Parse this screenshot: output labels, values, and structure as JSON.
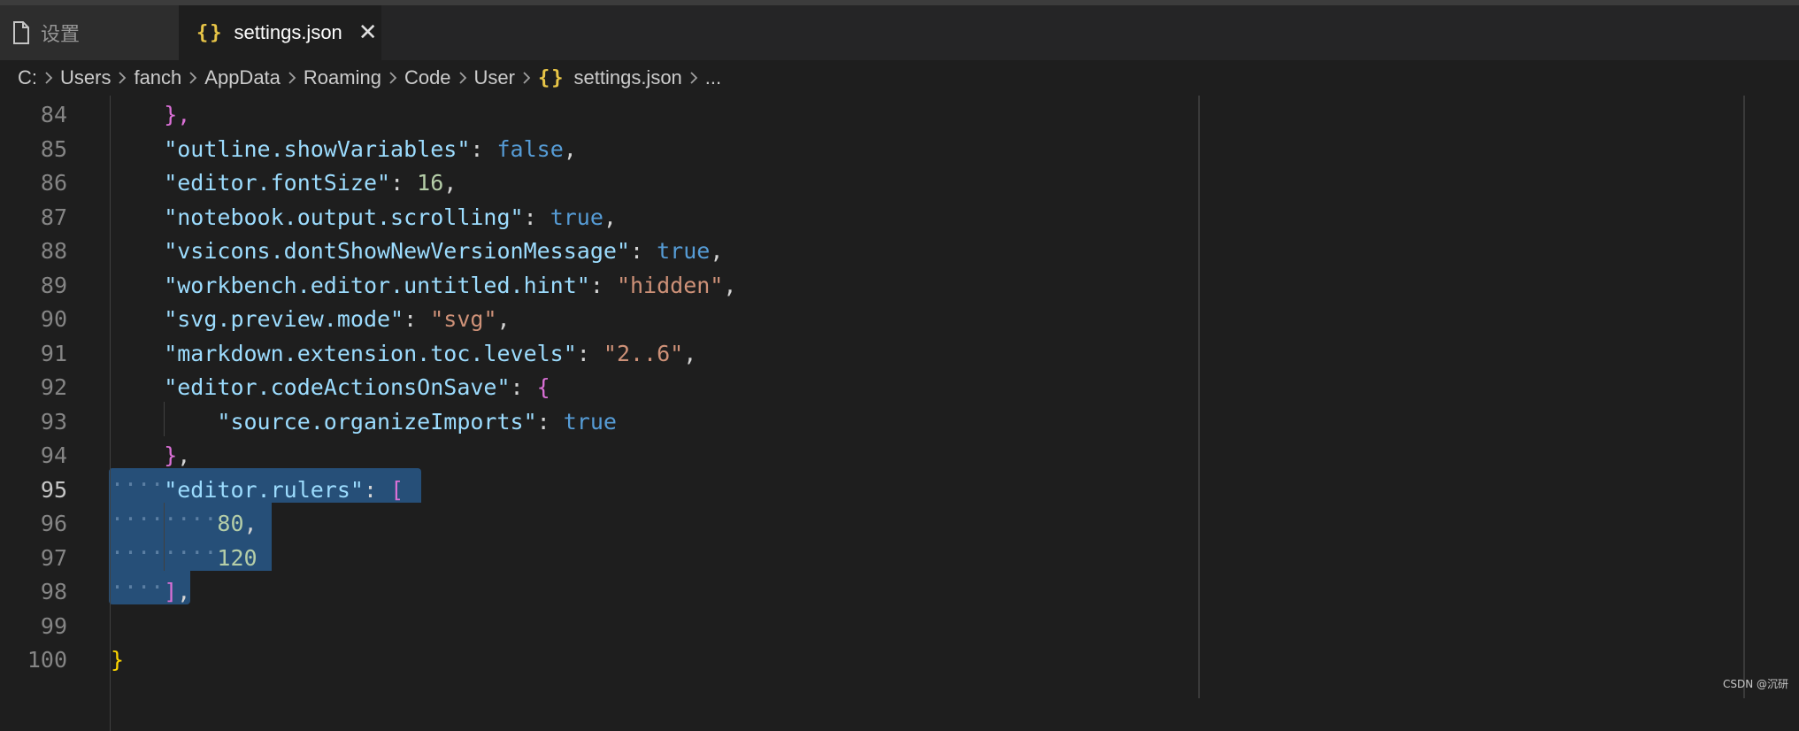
{
  "tabs": [
    {
      "label": "设置",
      "icon": "file-icon",
      "active": false
    },
    {
      "label": "settings.json",
      "icon": "json-braces-icon",
      "active": true,
      "close": "✕"
    }
  ],
  "breadcrumb": [
    "C:",
    "Users",
    "fanch",
    "AppData",
    "Roaming",
    "Code",
    "User",
    "settings.json",
    "..."
  ],
  "lines": [
    {
      "no": "84",
      "parts": [
        [
          "br1",
          "},"
        ]
      ]
    },
    {
      "no": "85",
      "parts": [
        [
          "k",
          "\"outline.showVariables\""
        ],
        [
          "p",
          ": "
        ],
        [
          "b",
          "false"
        ],
        [
          "p",
          ","
        ]
      ]
    },
    {
      "no": "86",
      "parts": [
        [
          "k",
          "\"editor.fontSize\""
        ],
        [
          "p",
          ": "
        ],
        [
          "n",
          "16"
        ],
        [
          "p",
          ","
        ]
      ]
    },
    {
      "no": "87",
      "parts": [
        [
          "k",
          "\"notebook.output.scrolling\""
        ],
        [
          "p",
          ": "
        ],
        [
          "b",
          "true"
        ],
        [
          "p",
          ","
        ]
      ]
    },
    {
      "no": "88",
      "parts": [
        [
          "k",
          "\"vsicons.dontShowNewVersionMessage\""
        ],
        [
          "p",
          ": "
        ],
        [
          "b",
          "true"
        ],
        [
          "p",
          ","
        ]
      ]
    },
    {
      "no": "89",
      "parts": [
        [
          "k",
          "\"workbench.editor.untitled.hint\""
        ],
        [
          "p",
          ": "
        ],
        [
          "s",
          "\"hidden\""
        ],
        [
          "p",
          ","
        ]
      ]
    },
    {
      "no": "90",
      "parts": [
        [
          "k",
          "\"svg.preview.mode\""
        ],
        [
          "p",
          ": "
        ],
        [
          "s",
          "\"svg\""
        ],
        [
          "p",
          ","
        ]
      ]
    },
    {
      "no": "91",
      "parts": [
        [
          "k",
          "\"markdown.extension.toc.levels\""
        ],
        [
          "p",
          ": "
        ],
        [
          "s",
          "\"2..6\""
        ],
        [
          "p",
          ","
        ]
      ]
    },
    {
      "no": "92",
      "parts": [
        [
          "k",
          "\"editor.codeActionsOnSave\""
        ],
        [
          "p",
          ": "
        ],
        [
          "br1",
          "{"
        ]
      ]
    },
    {
      "no": "93",
      "indent": 2,
      "parts": [
        [
          "k",
          "\"source.organizeImports\""
        ],
        [
          "p",
          ": "
        ],
        [
          "b",
          "true"
        ]
      ]
    },
    {
      "no": "94",
      "parts": [
        [
          "br1",
          "}"
        ],
        [
          "p",
          ","
        ]
      ]
    },
    {
      "no": "95",
      "current": true,
      "parts": [
        [
          "k",
          "\"editor.rulers\""
        ],
        [
          "p",
          ": "
        ],
        [
          "br1",
          "["
        ]
      ]
    },
    {
      "no": "96",
      "indent": 2,
      "parts": [
        [
          "n",
          "80"
        ],
        [
          "p",
          ","
        ]
      ]
    },
    {
      "no": "97",
      "indent": 2,
      "parts": [
        [
          "n",
          "120"
        ]
      ]
    },
    {
      "no": "98",
      "parts": [
        [
          "br1",
          "]"
        ],
        [
          "p",
          ","
        ]
      ]
    },
    {
      "no": "99",
      "parts": []
    },
    {
      "no": "100",
      "indent": 0,
      "parts": [
        [
          "br0",
          "}"
        ]
      ]
    }
  ],
  "watermark": "CSDN @沉研",
  "colors": {
    "background": "#1e1e1e",
    "selection": "#264f78",
    "key": "#9cdcfe",
    "boolean": "#569cd6",
    "number": "#b5cea8",
    "string": "#ce9178",
    "bracket": "#da70d6",
    "root_brace": "#ffd700"
  }
}
